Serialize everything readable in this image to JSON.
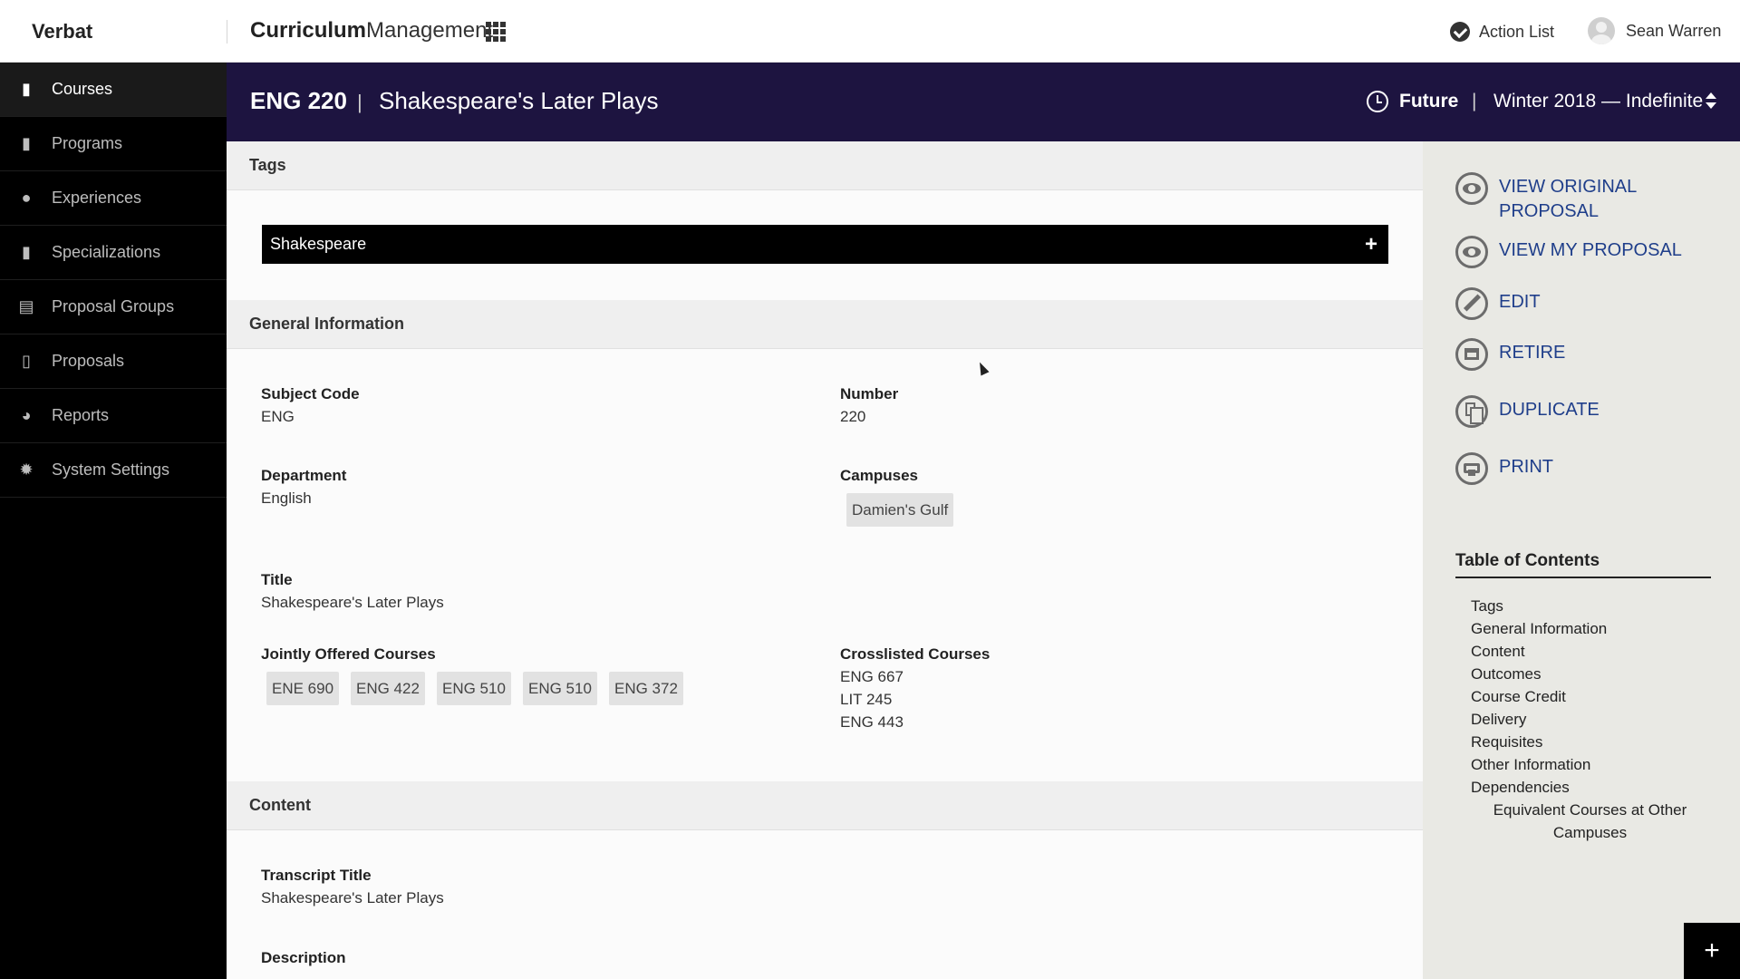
{
  "topbar": {
    "brand": "Verbat",
    "app_title_bold": "Curriculum",
    "app_title_regular": "Management",
    "action_list_label": "Action List",
    "user_name": "Sean Warren"
  },
  "sidebar": {
    "items": [
      {
        "label": "Courses",
        "icon": "book-icon",
        "active": true
      },
      {
        "label": "Programs",
        "icon": "books-icon"
      },
      {
        "label": "Experiences",
        "icon": "lightbulb-icon"
      },
      {
        "label": "Specializations",
        "icon": "books-icon"
      },
      {
        "label": "Proposal Groups",
        "icon": "proposal-groups-icon"
      },
      {
        "label": "Proposals",
        "icon": "document-icon"
      },
      {
        "label": "Reports",
        "icon": "pie-chart-icon"
      },
      {
        "label": "System Settings",
        "icon": "gear-icon"
      }
    ]
  },
  "header": {
    "code": "ENG 220",
    "separator": "|",
    "title": "Shakespeare's Later Plays",
    "status": "Future",
    "term": "Winter 2018 — Indefinite"
  },
  "sections": {
    "tags": {
      "heading": "Tags",
      "tag": "Shakespeare"
    },
    "general": {
      "heading": "General Information",
      "subject_code_label": "Subject Code",
      "subject_code": "ENG",
      "number_label": "Number",
      "number": "220",
      "department_label": "Department",
      "department": "English",
      "campuses_label": "Campuses",
      "campuses": [
        "Damien's Gulf"
      ],
      "title_label": "Title",
      "title": "Shakespeare's Later Plays",
      "jointly_label": "Jointly Offered Courses",
      "jointly": [
        "ENE 690",
        "ENG 422",
        "ENG 510",
        "ENG 510",
        "ENG 372"
      ],
      "crosslisted_label": "Crosslisted Courses",
      "crosslisted": [
        "ENG 667",
        "LIT 245",
        "ENG 443"
      ]
    },
    "content": {
      "heading": "Content",
      "transcript_label": "Transcript Title",
      "transcript": "Shakespeare's Later Plays",
      "description_label": "Description"
    }
  },
  "actions": [
    {
      "label": "VIEW ORIGINAL PROPOSAL",
      "icon": "eye-icon"
    },
    {
      "label": "VIEW MY PROPOSAL",
      "icon": "eye-icon"
    },
    {
      "label": "EDIT",
      "icon": "pencil-icon"
    },
    {
      "label": "RETIRE",
      "icon": "archive-box-icon"
    },
    {
      "label": "DUPLICATE",
      "icon": "copy-icon"
    },
    {
      "label": "PRINT",
      "icon": "printer-icon"
    }
  ],
  "toc": {
    "title": "Table of Contents",
    "items": [
      "Tags",
      "General Information",
      "Content",
      "Outcomes",
      "Course Credit",
      "Delivery",
      "Requisites",
      "Other Information",
      "Dependencies"
    ],
    "sub_items": [
      "Equivalent Courses at Other Campuses"
    ]
  },
  "fab_label": "+",
  "colors": {
    "header_bg": "#1d1440",
    "link": "#1f3e8a",
    "sidebar_bg": "#000000"
  }
}
